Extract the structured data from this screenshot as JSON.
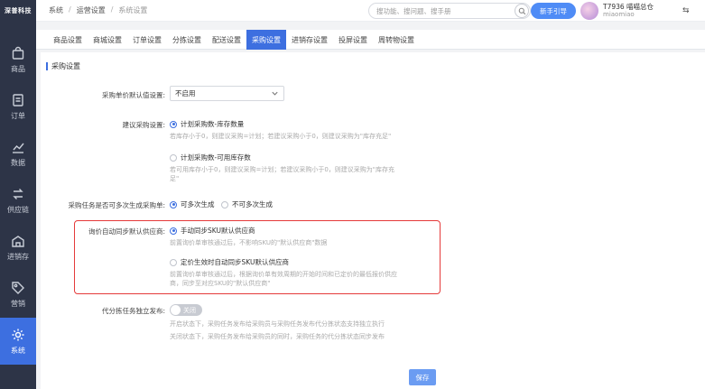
{
  "logo": {
    "text": "深普科技"
  },
  "sidebar": {
    "items": [
      {
        "label": "商品",
        "icon": "bag-icon"
      },
      {
        "label": "订单",
        "icon": "order-icon"
      },
      {
        "label": "数据",
        "icon": "chart-icon"
      },
      {
        "label": "供应链",
        "icon": "swap-arrows-icon"
      },
      {
        "label": "进销存",
        "icon": "warehouse-icon"
      },
      {
        "label": "营销",
        "icon": "tag-icon"
      },
      {
        "label": "系统",
        "icon": "gear-icon",
        "active": true
      }
    ]
  },
  "breadcrumb": {
    "level1": "系统",
    "level2": "运营设置",
    "level3": "系统设置"
  },
  "search": {
    "placeholder": "搜功能、搜问题、搜手册"
  },
  "topbar": {
    "guide_label": "新手引导",
    "user_name": "T7936 喵喵总仓",
    "user_account": "miaomiao"
  },
  "tabs": [
    {
      "label": "商品设置"
    },
    {
      "label": "商城设置"
    },
    {
      "label": "订单设置"
    },
    {
      "label": "分拣设置"
    },
    {
      "label": "配送设置"
    },
    {
      "label": "采购设置",
      "active": true
    },
    {
      "label": "进销存设置"
    },
    {
      "label": "投屏设置"
    },
    {
      "label": "周转物设置"
    }
  ],
  "section": {
    "title": "采购设置"
  },
  "form": {
    "default_price": {
      "label": "采购单价默认值设置:",
      "value": "不启用"
    },
    "suggest_qty": {
      "label": "建议采购设置:",
      "opt1": "计划采购数-库存数量",
      "opt1_hint": "若库存小于0，则建议采购=计划；若建议采购小于0，则建议采购为\"库存充足\"",
      "opt2": "计划采购数-可用库存数",
      "opt2_hint_1": "若可用库存小于0，则建议采购=计划；若建议采购小于0，则建议采购为\"库存充",
      "opt2_hint_2": "足\""
    },
    "multi_gen": {
      "label": "采购任务是否可多次生成采购单:",
      "opt1": "可多次生成",
      "opt2": "不可多次生成"
    },
    "auto_sync": {
      "label": "询价自动同步默认供应商:",
      "opt1": "手动同步SKU默认供应商",
      "opt1_hint": "前置询价单审核通过后，不影响SKU的\"默认供应商\"数据",
      "opt2": "定价生效时自动同步SKU默认供应商",
      "opt2_hint_1": "前置询价单审核通过后，根据询价单有效周期的开始时间和已定价的最低报价供应",
      "opt2_hint_2": "商，同步至对应SKU的\"默认供应商\""
    },
    "independent_publish": {
      "label": "代分拣任务独立发布:",
      "toggle_label": "关闭",
      "hint1": "开启状态下，采购任务发布给采购员与采购任务发布代分拣状态支持独立执行",
      "hint2": "关闭状态下，采购任务发布给采购员的同时，采购任务的代分拣状态同步发布"
    }
  },
  "save_label": "保存",
  "colors": {
    "primary": "#3d6fe0",
    "sidebar_bg": "#2d3447",
    "highlight_border": "#e53a3a"
  }
}
